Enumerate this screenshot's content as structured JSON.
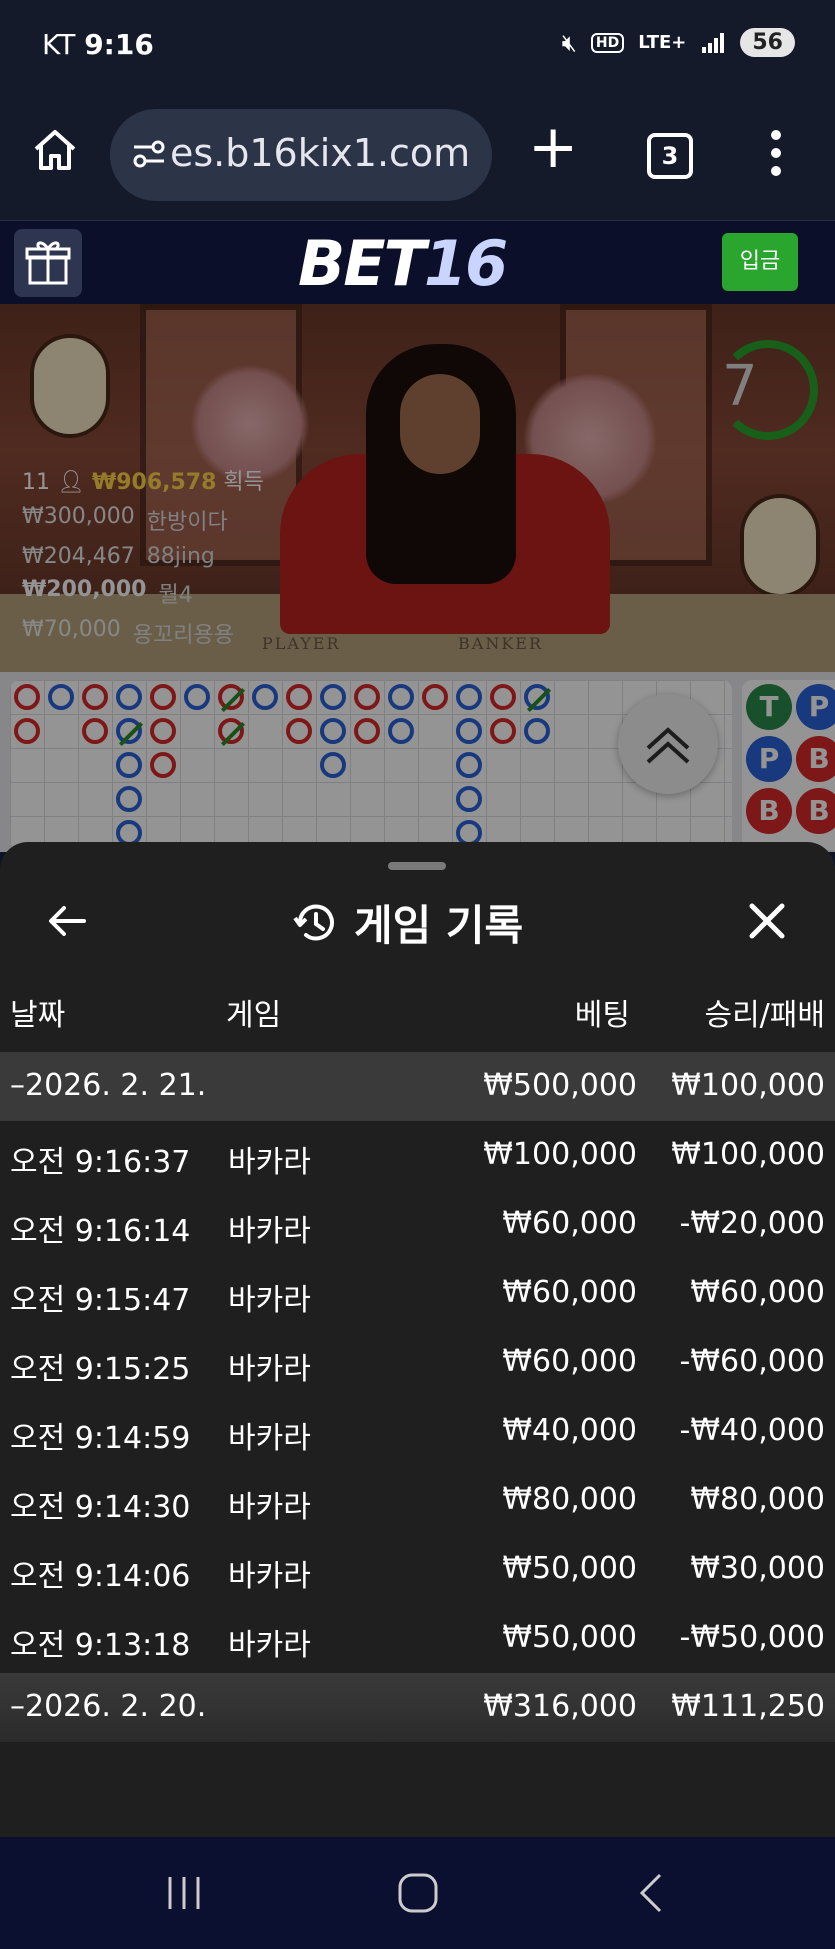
{
  "status_bar": {
    "carrier": "KT",
    "time": "9:16",
    "network": "LTE+",
    "hd": "HD",
    "battery": "56"
  },
  "browser": {
    "url": "es.b16kix1.com",
    "tab_count": "3"
  },
  "site": {
    "logo_main": "BET",
    "logo_num": "16",
    "deposit_label": "입금"
  },
  "live_video": {
    "countdown": "7",
    "winners_count": "11",
    "winners_total": "₩906,578",
    "winners_suffix": "획득",
    "winners": [
      {
        "amount": "₩300,000",
        "name": "한방이다"
      },
      {
        "amount": "₩204,467",
        "name": "88jing"
      },
      {
        "amount": "₩200,000",
        "name": "뭘4"
      },
      {
        "amount": "₩70,000",
        "name": "용꼬리용용"
      }
    ],
    "zone_player": "PLAYER",
    "zone_banker": "BANKER"
  },
  "roadmap_side": [
    "T",
    "P",
    "P",
    "B",
    "B",
    "B"
  ],
  "sheet": {
    "title": "게임 기록",
    "columns": {
      "date": "날짜",
      "game": "게임",
      "bet": "베팅",
      "win_loss": "승리/패배"
    },
    "groups": [
      {
        "date": "–2026. 2. 21.",
        "bet": "₩500,000",
        "win_loss": "₩100,000",
        "rows": [
          {
            "time": "오전 9:16:37",
            "game": "바카라",
            "bet": "₩100,000",
            "win_loss": "₩100,000"
          },
          {
            "time": "오전 9:16:14",
            "game": "바카라",
            "bet": "₩60,000",
            "win_loss": "-₩20,000"
          },
          {
            "time": "오전 9:15:47",
            "game": "바카라",
            "bet": "₩60,000",
            "win_loss": "₩60,000"
          },
          {
            "time": "오전 9:15:25",
            "game": "바카라",
            "bet": "₩60,000",
            "win_loss": "-₩60,000"
          },
          {
            "time": "오전 9:14:59",
            "game": "바카라",
            "bet": "₩40,000",
            "win_loss": "-₩40,000"
          },
          {
            "time": "오전 9:14:30",
            "game": "바카라",
            "bet": "₩80,000",
            "win_loss": "₩80,000"
          },
          {
            "time": "오전 9:14:06",
            "game": "바카라",
            "bet": "₩50,000",
            "win_loss": "₩30,000"
          },
          {
            "time": "오전 9:13:18",
            "game": "바카라",
            "bet": "₩50,000",
            "win_loss": "-₩50,000"
          }
        ]
      },
      {
        "date": "–2026. 2. 20.",
        "bet": "₩316,000",
        "win_loss": "₩111,250"
      }
    ]
  }
}
